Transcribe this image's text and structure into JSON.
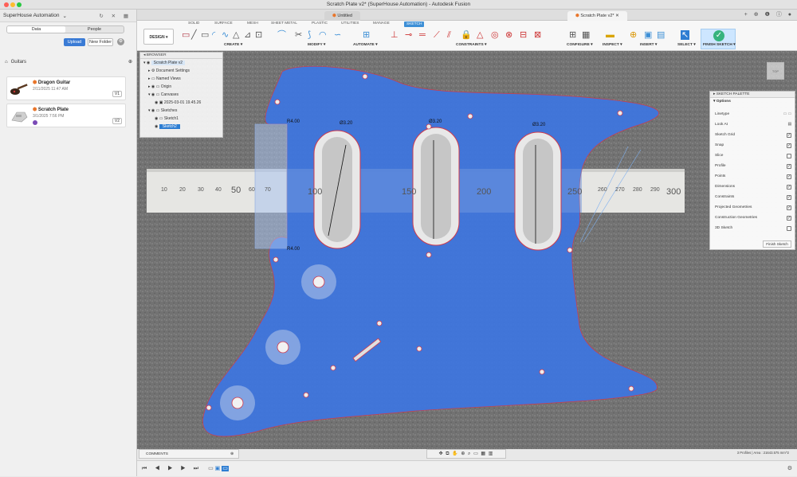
{
  "window": {
    "title": "Scratch Plate v2* (SuperHouse Automation) - Autodesk Fusion"
  },
  "left_panel": {
    "team": "SuperHouse Automation",
    "tabs": [
      "Data",
      "People"
    ],
    "upload_label": "Upload",
    "new_folder_label": "New Folder",
    "breadcrumb": "Guitars",
    "files": [
      {
        "name": "Dragon Guitar",
        "date": "2/11/2025 11:47 AM",
        "version": "V1"
      },
      {
        "name": "Scratch Plate",
        "date": "3/1/2025 7:56 PM",
        "version": "V2"
      }
    ]
  },
  "doc_tabs": {
    "first": "Untitled",
    "second": "Scratch Plate v2*"
  },
  "toolbar": {
    "design_label": "DESIGN",
    "tabs": [
      "SOLID",
      "SURFACE",
      "MESH",
      "SHEET METAL",
      "PLASTIC",
      "UTILITIES",
      "MANAGE",
      "SKETCH"
    ],
    "active_tab": "SKETCH",
    "groups": [
      "CREATE",
      "MODIFY",
      "AUTOMATE",
      "CONSTRAINTS",
      "CONFIGURE",
      "INSPECT",
      "INSERT",
      "SELECT",
      "FINISH SKETCH"
    ]
  },
  "browser": {
    "title": "BROWSER",
    "root": "Scratch Plate v2",
    "items": [
      "Document Settings",
      "Named Views",
      "Origin",
      "Canvases",
      "2025-03-01 19.45.26",
      "Sketches",
      "Sketch1",
      "Sketch2"
    ]
  },
  "sketch_palette": {
    "title": "SKETCH PALETTE",
    "section": "Options",
    "options": [
      {
        "label": "Linetype",
        "checked": false
      },
      {
        "label": "Look At",
        "checked": false
      },
      {
        "label": "Sketch Grid",
        "checked": true
      },
      {
        "label": "Snap",
        "checked": true
      },
      {
        "label": "Slice",
        "checked": false
      },
      {
        "label": "Profile",
        "checked": true
      },
      {
        "label": "Points",
        "checked": true
      },
      {
        "label": "Dimensions",
        "checked": true
      },
      {
        "label": "Constraints",
        "checked": true
      },
      {
        "label": "Projected Geometries",
        "checked": true
      },
      {
        "label": "Construction Geometries",
        "checked": true
      },
      {
        "label": "3D Sketch",
        "checked": false
      }
    ],
    "finish_label": "Finish Sketch"
  },
  "canvas": {
    "ruler_numbers": [
      "10",
      "20",
      "30",
      "40",
      "50",
      "60",
      "70",
      "100",
      "150",
      "200",
      "250",
      "260",
      "270",
      "280",
      "290",
      "300"
    ],
    "dims": [
      "R4.00",
      "R4.00",
      "Ø3.20",
      "Ø3.20",
      "Ø3.20"
    ]
  },
  "comments": {
    "label": "COMMENTS"
  },
  "status_text": "3 Profiles | Area : 21643.575 mm^2",
  "colors": {
    "sketch_fill": "#3d75e0",
    "accent": "#3d8fd6",
    "finish_green": "#36b37e"
  }
}
